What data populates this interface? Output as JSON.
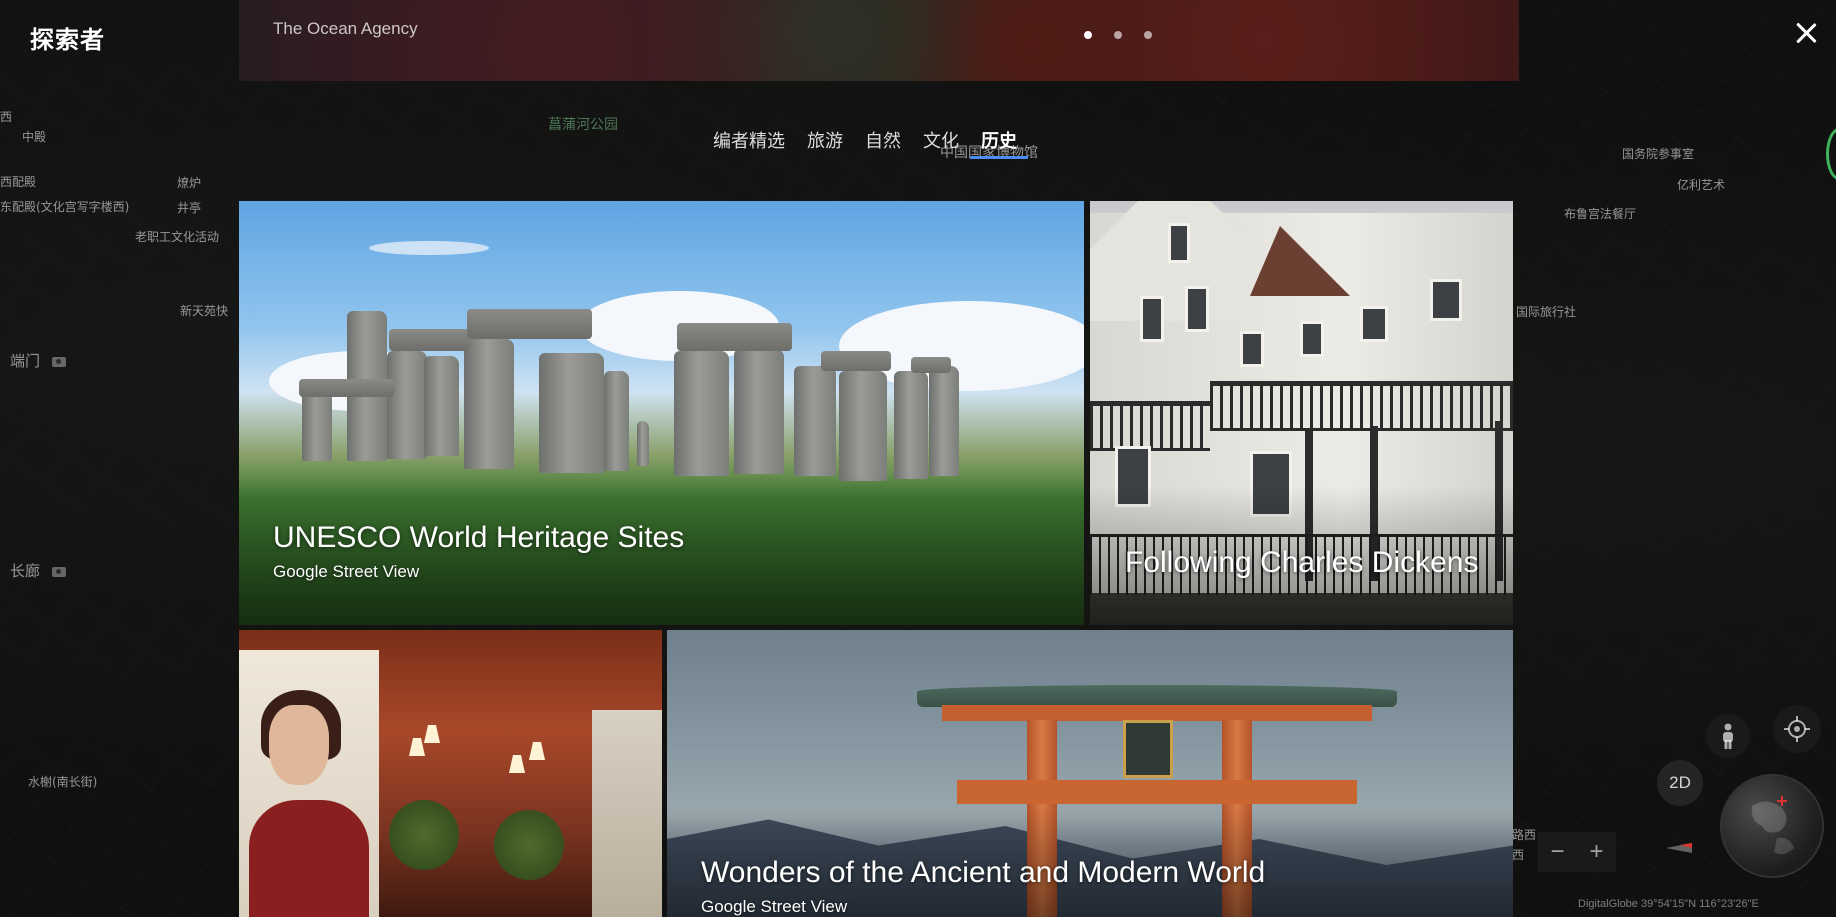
{
  "app": {
    "title": "探索者"
  },
  "banner": {
    "credit": "The Ocean Agency",
    "dots": 3,
    "active_dot": 0
  },
  "tabs": [
    {
      "label": "编者精选",
      "active": false
    },
    {
      "label": "旅游",
      "active": false
    },
    {
      "label": "自然",
      "active": false
    },
    {
      "label": "文化",
      "active": false
    },
    {
      "label": "历史",
      "active": true
    }
  ],
  "cards": {
    "unesco": {
      "title": "UNESCO World Heritage Sites",
      "subtitle": "Google Street View"
    },
    "dickens": {
      "title": "Following Charles Dickens"
    },
    "paris": {
      "title": ""
    },
    "torii": {
      "title": "Wonders of the Ancient and Modern World",
      "subtitle": "Google Street View"
    }
  },
  "map": {
    "labels": {
      "l1": "中殿",
      "l2": "西配殿",
      "l3": "东配殿(文化宫写字楼西)",
      "l4": "燎炉",
      "l5": "井亭",
      "l6": "老职工文化活动",
      "l7": "新天苑快",
      "l8": "端门",
      "l9": "长廊",
      "l10": "水榭(南长街)",
      "l11": "菖蒲河公园",
      "l12": "中国国家博物馆",
      "l13": "国务院参事室",
      "l14": "亿利艺术",
      "l15": "布鲁宫法餐厅",
      "l16": "国际旅行社",
      "l17": "路西",
      "l18": "西"
    },
    "controls": {
      "mode_label": "2D",
      "zoom_out": "−",
      "zoom_in": "+"
    },
    "credit": "DigitalGlobe    39°54'15\"N 116°23'26\"E"
  },
  "colors": {
    "accent": "#4a8ef0",
    "brand_green": "#3fb25b"
  }
}
